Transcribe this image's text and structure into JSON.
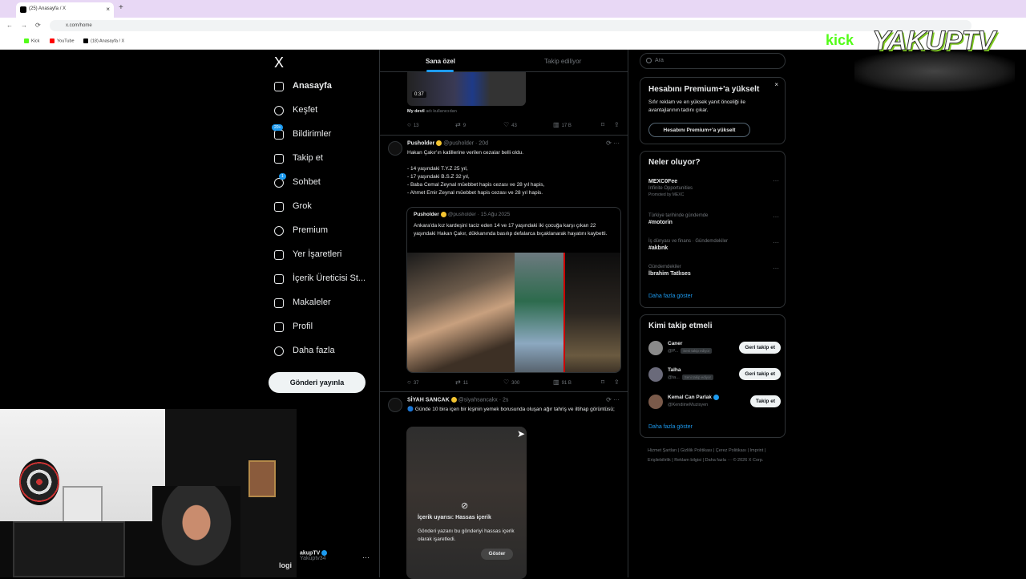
{
  "browser": {
    "tab_title": "(25) Anasayfa / X",
    "tab_close": "×",
    "new_tab": "+",
    "back": "←",
    "forward": "→",
    "reload": "⟳",
    "url": "x.com/home",
    "bookmarks": [
      {
        "label": "Kick",
        "color": "#53fc18"
      },
      {
        "label": "YouTube",
        "color": "#ff0000"
      },
      {
        "label": "(18) Anasayfa / X",
        "color": "#000000"
      }
    ]
  },
  "overlay": {
    "kick": "kick",
    "brand": "YAKUPTV"
  },
  "nav": {
    "logo": "X",
    "items": [
      {
        "label": "Anasayfa",
        "bold": true
      },
      {
        "label": "Keşfet"
      },
      {
        "label": "Bildirimler",
        "badge": "20+"
      },
      {
        "label": "Takip et"
      },
      {
        "label": "Sohbet",
        "badge": "1"
      },
      {
        "label": "Grok"
      },
      {
        "label": "Premium"
      },
      {
        "label": "Yer İşaretleri"
      },
      {
        "label": "İçerik Üreticisi St..."
      },
      {
        "label": "Makaleler"
      },
      {
        "label": "Profil"
      },
      {
        "label": "Daha fazla"
      }
    ],
    "post_button": "Gönderi yayınla",
    "account": {
      "name": "akupTV",
      "handle": "Yakuptv34",
      "more": "···"
    }
  },
  "feed": {
    "tabs": [
      "Sana özel",
      "Takip ediliyor"
    ],
    "tweet0": {
      "video_time": "0:37",
      "caption_user": "My devil",
      "caption_rest": " adı kullanıcıdan",
      "stats": {
        "reply": "13",
        "retweet": "9",
        "like": "43",
        "views": "17 B"
      }
    },
    "tweet1": {
      "name": "Pusholder",
      "handle": "@pusholder · 20d",
      "lines": [
        "Hakan Çakır'ın katillerine verilen cezalar belli oldu.",
        "",
        "- 14 yaşındaki T.Y.Z 25 yıl,",
        "- 17 yaşındaki B.S.Z 32 yıl,",
        "- Baba Cemal Zeynal müebbet hapis cezası ve 28 yıl hapis,",
        "- Ahmet Emir Zeynal müebbet hapis cezası ve 28 yıl hapis."
      ],
      "quote": {
        "name": "Pusholder",
        "handle": "@pusholder · 15 Ağu 2025",
        "text": "Ankara'da kız kardeşini taciz eden 14 ve 17 yaşındaki iki çocuğa karşı çıkan 22 yaşındaki Hakan Çakır, dükkanında basılıp defalarca bıçaklanarak hayatını kaybetti."
      },
      "stats": {
        "reply": "37",
        "retweet": "11",
        "like": "300",
        "views": "91 B"
      }
    },
    "tweet2": {
      "name": "SİYAH SANCAK",
      "handle": "@siyahsancakx · 2s",
      "text": "🔵 Günde 10 bira içen bir kişinin yemek borusunda oluşan ağır tahriş ve iltihap görüntüsü;",
      "sensitive_title": "İçerik uyarısı: Hassas içerik",
      "sensitive_desc": "Gönderi yazanı bu gönderiyi hassas içerik olarak işaretledi.",
      "show_button": "Göster"
    }
  },
  "sidebar": {
    "search_placeholder": "Ara",
    "premium": {
      "title": "Hesabını Premium+'a yükselt",
      "text": "Sıfır reklam ve en yüksek yanıt önceliği ile avantajlarının tadını çıkar.",
      "button": "Hesabını Premium+'a yükselt",
      "close": "×"
    },
    "trends": {
      "title": "Neler oluyor?",
      "items": [
        {
          "meta": "",
          "name": "MEXC0Fee",
          "sub": "Infinite Opportunities",
          "promo": "Promoted by MEXC"
        },
        {
          "meta": "Türkiye tarihinde gündemde",
          "name": "#motorin",
          "sub": "",
          "promo": ""
        },
        {
          "meta": "İş dünyası ve finans · Gündemdekiler",
          "name": "#akbnk",
          "sub": "",
          "promo": ""
        },
        {
          "meta": "Gündemdekiler",
          "name": "İbrahim Tatlıses",
          "sub": "",
          "promo": ""
        }
      ],
      "more": "Daha fazla göster"
    },
    "who": {
      "title": "Kimi takip etmeli",
      "items": [
        {
          "name": "Caner",
          "handle": "@P...",
          "tag": "Seni takip ediyor",
          "button": "Geri takip et",
          "verified": false
        },
        {
          "name": "Talha",
          "handle": "@ta...",
          "tag": "Seni takip ediyor",
          "button": "Geri takip et",
          "verified": false
        },
        {
          "name": "Kemal Can Parlak",
          "handle": "@KendiineMuzisyen",
          "tag": "",
          "button": "Takip et",
          "verified": true
        }
      ],
      "more": "Daha fazla göster"
    },
    "footer": "Hizmet Şartları | Gizlilik Politikası | Çerez Politikası | Imprint | Erişilebilirlik | Reklam bilgisi | Daha fazla ··· © 2026 X Corp."
  },
  "webcam": {
    "logi": "logi"
  }
}
